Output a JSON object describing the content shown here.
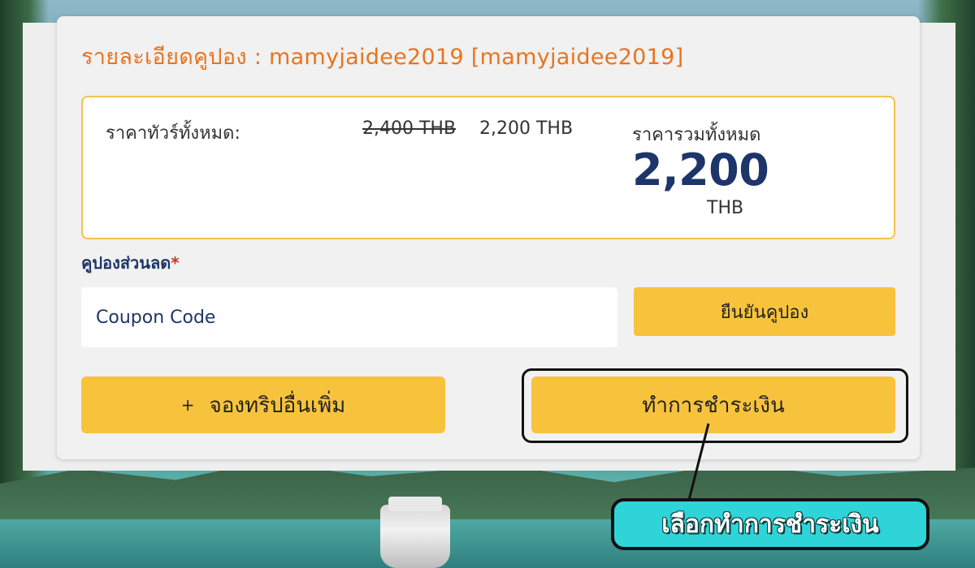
{
  "coupon_detail": {
    "title": "รายละเอียดคูปอง : mamyjaidee2019 [mamyjaidee2019]"
  },
  "pricing": {
    "tour_price_label": "ราคาทัวร์ทั้งหมด:",
    "original_price": "2,400 THB",
    "discounted_price": "2,200 THB",
    "total_label": "ราคารวมทั้งหมด",
    "total_value": "2,200",
    "total_currency": "THB"
  },
  "coupon_form": {
    "label": "คูปองส่วนลด",
    "required_mark": "*",
    "input_placeholder": "Coupon Code",
    "confirm_button": "ยืนยันคูปอง"
  },
  "actions": {
    "add_trip_icon": "+",
    "add_trip_label": "จองทริปอื่นเพิ่ม",
    "pay_label": "ทำการชำระเงิน"
  },
  "annotation": {
    "callout_text": "เลือกทำการชำระเงิน"
  },
  "colors": {
    "accent_orange": "#e8741e",
    "button_yellow": "#f8c33c",
    "navy": "#1d3568",
    "box_border": "#f2c14e",
    "callout_cyan": "#2fd4d8"
  }
}
